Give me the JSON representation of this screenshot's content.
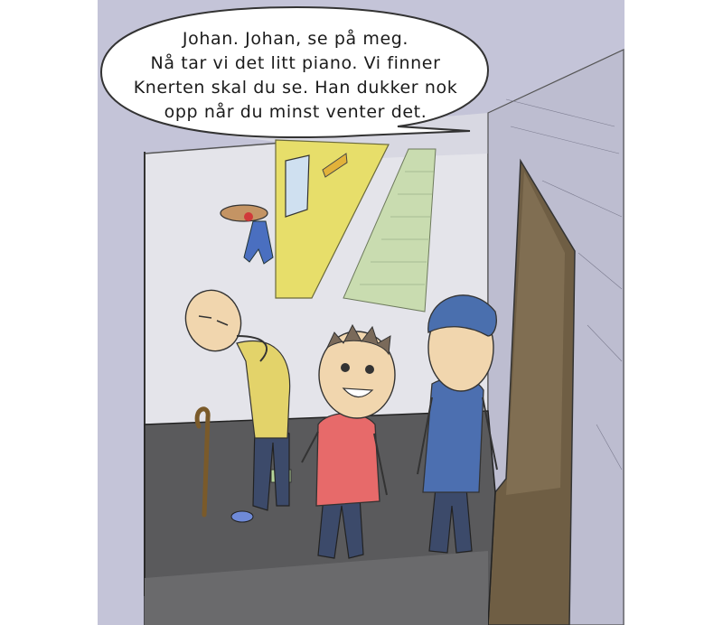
{
  "speech_bubble": {
    "lines": [
      "Johan. Johan, se på meg.",
      "Nå tar vi det litt piano. Vi finner",
      "Knerten skal du se. Han dukker nok",
      "opp når du minst venter det."
    ]
  },
  "colors": {
    "panel_background": "#c4c4d8",
    "floor": "#5a5a5c",
    "yellow_wall": "#e7de6a",
    "rug": "#c9dcb0",
    "boy_shirt": "#e76a6a",
    "man_jacket": "#4c6fb0",
    "old_man_shirt": "#e3d36a",
    "trousers": "#3c4a6a",
    "skin": "#f1d6ae",
    "doorway": "#6f5e44"
  }
}
